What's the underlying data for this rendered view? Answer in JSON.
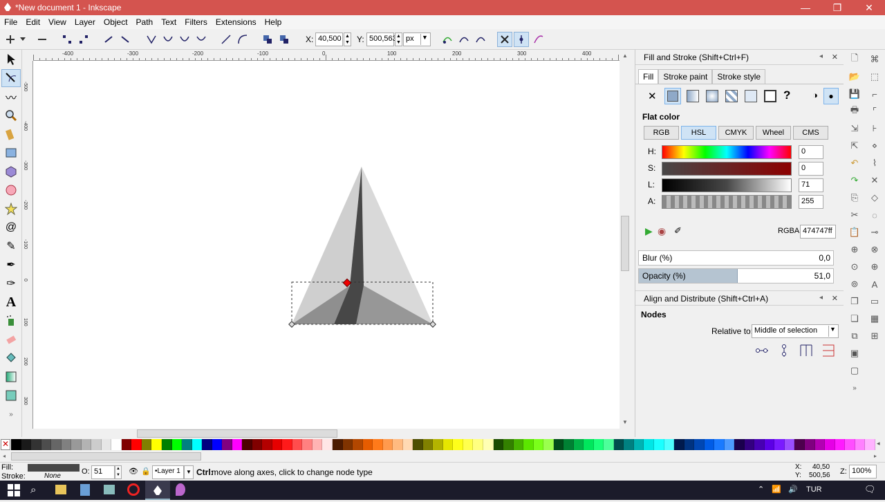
{
  "window": {
    "title": "*New document 1 - Inkscape",
    "min_label": "—",
    "max_label": "❐",
    "close_label": "✕"
  },
  "menu": [
    "File",
    "Edit",
    "View",
    "Layer",
    "Object",
    "Path",
    "Text",
    "Filters",
    "Extensions",
    "Help"
  ],
  "controls": {
    "x_label": "X:",
    "x_value": "40,500",
    "y_label": "Y:",
    "y_value": "500,563",
    "unit": "px"
  },
  "ruler": {
    "h_labels": [
      "-400",
      "-300",
      "-200",
      "-100",
      "0",
      "100",
      "200",
      "300",
      "400"
    ],
    "v_labels": [
      "-500",
      "-400",
      "-300",
      "-200",
      "-100",
      "0",
      "100",
      "200",
      "300"
    ]
  },
  "fill_stroke": {
    "title": "Fill and Stroke (Shift+Ctrl+F)",
    "tabs": [
      "Fill",
      "Stroke paint",
      "Stroke style"
    ],
    "paint_types": [
      "✕",
      "flat",
      "linear",
      "radial",
      "pattern",
      "swatch",
      "unset",
      "?"
    ],
    "flat_color_label": "Flat color",
    "modes": [
      "RGB",
      "HSL",
      "CMYK",
      "Wheel",
      "CMS"
    ],
    "selected_mode": "HSL",
    "channels": [
      {
        "label": "H:",
        "value": "0"
      },
      {
        "label": "S:",
        "value": "0"
      },
      {
        "label": "L:",
        "value": "71"
      },
      {
        "label": "A:",
        "value": "255"
      }
    ],
    "rgba_label": "RGBA:",
    "rgba_value": "474747ff",
    "blur_label": "Blur (%)",
    "blur_value": "0,0",
    "opacity_label": "Opacity (%)",
    "opacity_value": "51,0",
    "opacity_fraction": 0.51
  },
  "align": {
    "title": "Align and Distribute (Shift+Ctrl+A)",
    "section": "Nodes",
    "relative_label": "Relative to:",
    "relative_value": "Middle of selection"
  },
  "status": {
    "fill_label": "Fill:",
    "stroke_label": "Stroke:",
    "stroke_value": "None",
    "fill_color": "#474747",
    "o_label": "O:",
    "o_value": "51",
    "layer": "•Layer 1",
    "message_bold": "Ctrl:",
    "message": " move along axes, click to change node type",
    "x_label": "X:",
    "x_value": "40,50",
    "y_label": "Y:",
    "y_value": "500,56",
    "z_label": "Z:",
    "zoom": "100%"
  },
  "taskbar": {
    "lang": "TUR"
  },
  "palette_colors": [
    "#000000",
    "#1a1a1a",
    "#333333",
    "#4d4d4d",
    "#666666",
    "#808080",
    "#999999",
    "#b3b3b3",
    "#cccccc",
    "#e6e6e6",
    "#ffffff",
    "#800000",
    "#ff0000",
    "#808000",
    "#ffff00",
    "#008000",
    "#00ff00",
    "#008080",
    "#00ffff",
    "#000080",
    "#0000ff",
    "#800080",
    "#ff00ff",
    "#4d0000",
    "#800000",
    "#b30000",
    "#e60000",
    "#ff1a1a",
    "#ff4d4d",
    "#ff8080",
    "#ffb3b3",
    "#ffe6e6",
    "#4d1a00",
    "#803300",
    "#b34700",
    "#e65c00",
    "#ff7a1a",
    "#ff9a4d",
    "#ffba80",
    "#ffd9b3",
    "#4d4d00",
    "#808000",
    "#b3b300",
    "#e6e600",
    "#ffff1a",
    "#ffff4d",
    "#ffff80",
    "#ffffb3",
    "#1a4d00",
    "#338000",
    "#47b300",
    "#5ce600",
    "#7aff1a",
    "#9aff4d",
    "#004d1a",
    "#008033",
    "#00b347",
    "#00e65c",
    "#1aff7a",
    "#4dff9a",
    "#004d4d",
    "#008080",
    "#00b3b3",
    "#00e6e6",
    "#1affff",
    "#4dffff",
    "#001a4d",
    "#003380",
    "#0047b3",
    "#005ce6",
    "#1a7aff",
    "#4d9aff",
    "#1a004d",
    "#330080",
    "#4700b3",
    "#5c00e6",
    "#7a1aff",
    "#9a4dff",
    "#4d004d",
    "#800080",
    "#b300b3",
    "#e600e6",
    "#ff1aff",
    "#ff4dff",
    "#ff80ff",
    "#ffb3ff"
  ]
}
